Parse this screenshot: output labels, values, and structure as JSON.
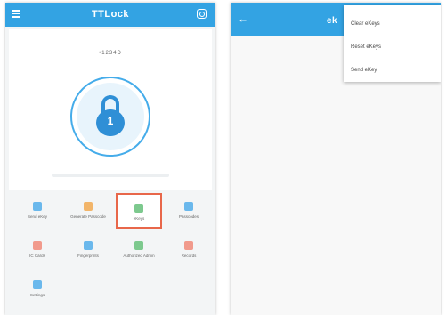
{
  "left_screen": {
    "title": "TTLock",
    "lock_name": "•1234D",
    "menu_icon": "menu-icon",
    "settings_icon": "settings-icon",
    "tiles": [
      {
        "label": "Send eKey",
        "icon": "ekey-icon",
        "color": "blue"
      },
      {
        "label": "Generate Passcode",
        "icon": "passcode-icon",
        "color": "orange"
      },
      {
        "label": "eKeys",
        "icon": "user-icon",
        "color": "green"
      },
      {
        "label": "Passcodes",
        "icon": "list-icon",
        "color": "blue"
      },
      {
        "label": "IC Cards",
        "icon": "card-icon",
        "color": "red"
      },
      {
        "label": "Fingerprints",
        "icon": "fingerprint-icon",
        "color": "blue"
      },
      {
        "label": "Authorized Admin",
        "icon": "admin-icon",
        "color": "green"
      },
      {
        "label": "Records",
        "icon": "records-icon",
        "color": "red"
      },
      {
        "label": "Settings",
        "icon": "gear-icon",
        "color": "blue"
      }
    ]
  },
  "right_screen": {
    "title": "ek",
    "menu_items": [
      {
        "label": "Clear eKeys"
      },
      {
        "label": "Reset eKeys"
      },
      {
        "label": "Send eKey"
      }
    ]
  }
}
